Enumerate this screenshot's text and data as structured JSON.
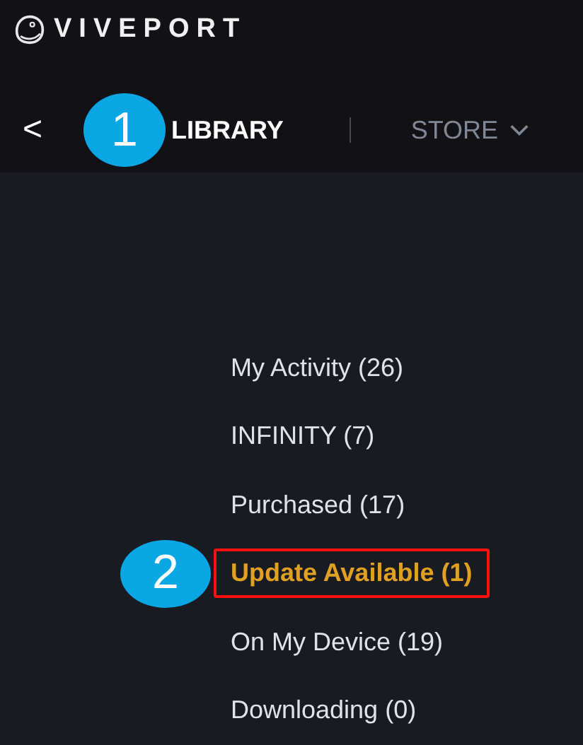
{
  "brand": "VIVEPORT",
  "nav": {
    "back": "<",
    "tabs": [
      {
        "label": "LIBRARY",
        "selected": true,
        "callout": "1"
      },
      {
        "label": "STORE",
        "selected": false
      }
    ]
  },
  "menu": [
    {
      "label": "My Activity (26)",
      "selected": false
    },
    {
      "label": "INFINITY (7)",
      "selected": false
    },
    {
      "label": "Purchased (17)",
      "selected": false
    },
    {
      "label": "Update Available (1)",
      "selected": true,
      "callout": "2"
    },
    {
      "label": "On My Device (19)",
      "selected": false
    },
    {
      "label": "Downloading (0)",
      "selected": false
    }
  ]
}
